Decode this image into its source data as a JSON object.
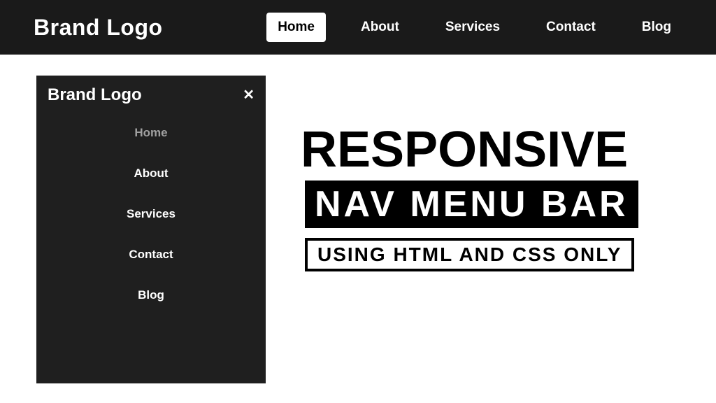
{
  "brand": "Brand Logo",
  "nav": {
    "items": [
      {
        "label": "Home",
        "active": true
      },
      {
        "label": "About",
        "active": false
      },
      {
        "label": "Services",
        "active": false
      },
      {
        "label": "Contact",
        "active": false
      },
      {
        "label": "Blog",
        "active": false
      }
    ]
  },
  "mobile": {
    "brand": "Brand Logo",
    "close": "✕",
    "items": [
      {
        "label": "Home",
        "active": true
      },
      {
        "label": "About",
        "active": false
      },
      {
        "label": "Services",
        "active": false
      },
      {
        "label": "Contact",
        "active": false
      },
      {
        "label": "Blog",
        "active": false
      }
    ]
  },
  "hero": {
    "line1": "RESPONSIVE",
    "line2": "NAV MENU BAR",
    "line3": "USING HTML AND CSS ONLY"
  }
}
